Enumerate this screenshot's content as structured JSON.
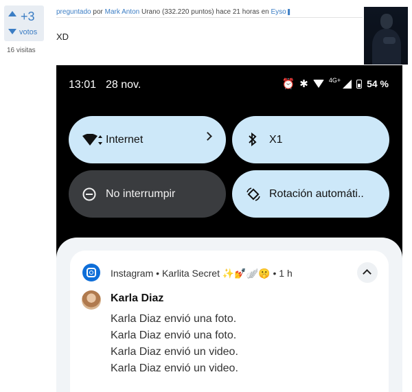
{
  "post": {
    "votes": "+3",
    "votes_label": "votos",
    "views": "16 visitas",
    "meta": {
      "asked_label": "preguntado",
      "by_label": "por",
      "author": "Mark Anton",
      "rank_points": "Urano (332.220 puntos)",
      "time": "hace 21 horas",
      "in_label": "en",
      "category": "Eyso"
    },
    "text": "XD"
  },
  "phone": {
    "status_bar": {
      "time": "13:01",
      "date": "28 nov.",
      "network_type": "4G+",
      "battery": "54 %",
      "icons": [
        "alarm-icon",
        "bluetooth-icon",
        "wifi-icon",
        "signal-icon",
        "battery-icon"
      ]
    },
    "tiles": [
      {
        "label": "Internet",
        "icon": "wifi-icon",
        "state": "on"
      },
      {
        "label": "X1",
        "icon": "bluetooth-icon",
        "state": "on"
      },
      {
        "label": "No interrumpir",
        "icon": "dnd-icon",
        "state": "off"
      },
      {
        "label": "Rotación automáti..",
        "icon": "rotation-icon",
        "state": "on"
      }
    ],
    "notification": {
      "app": "Instagram",
      "separator": "•",
      "account": "Karlita Secret ✨💅🪽🤫",
      "time": "1 h",
      "sender": "Karla Diaz",
      "messages": [
        "Karla Diaz envió una foto.",
        "Karla Diaz envió una foto.",
        "Karla Diaz envió un video.",
        "Karla Diaz envió un video."
      ]
    }
  },
  "colors": {
    "link": "#3b7dc4",
    "tile_active": "#cde8f9",
    "tile_inactive": "#3a3c3f",
    "instagram_badge": "#0e6ed8"
  }
}
